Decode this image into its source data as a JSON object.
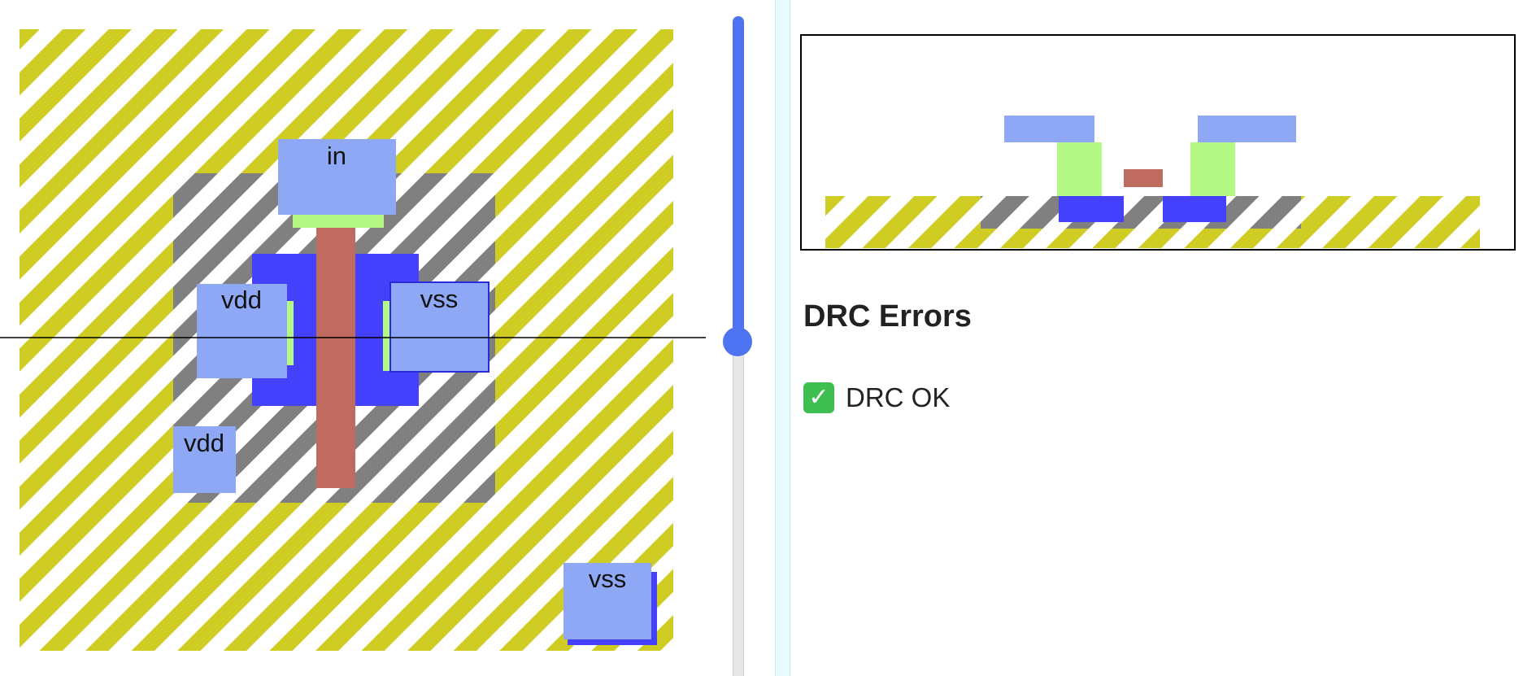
{
  "layout": {
    "net_labels": {
      "in": "in",
      "vdd_left": "vdd",
      "vss_right": "vss",
      "vdd_lower": "vdd",
      "vss_corner": "vss"
    }
  },
  "slider": {
    "value_fraction": 0.47
  },
  "drc": {
    "title": "DRC Errors",
    "status_icon": "check-mark-icon",
    "status_text": "DRC OK"
  },
  "colors": {
    "well_stripe": "#cfcc23",
    "diffusion_stripe": "#808080",
    "active": "#4540fb",
    "poly": "#c06b60",
    "contact": "#b4f886",
    "metal1": "#8ea8f5",
    "slider_accent": "#4e73f0"
  }
}
